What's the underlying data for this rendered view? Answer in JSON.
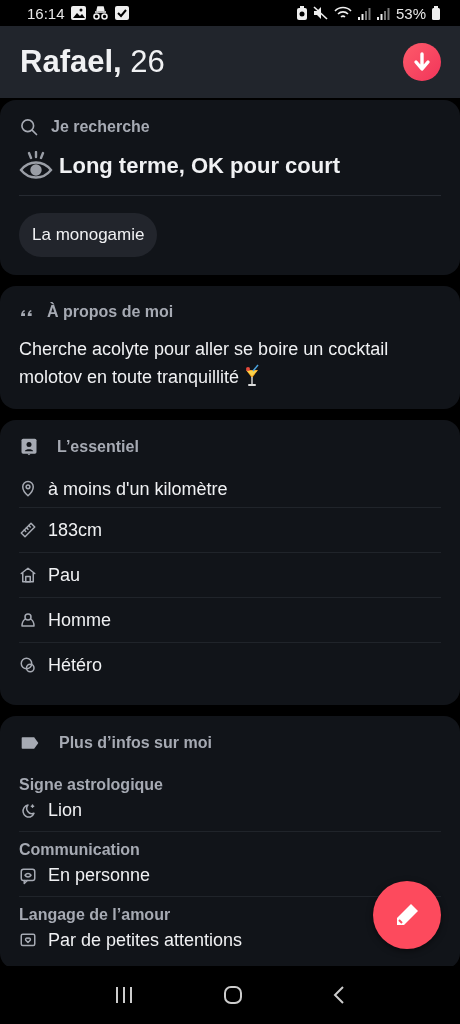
{
  "status_bar": {
    "time": "16:14",
    "battery": "53%"
  },
  "header": {
    "name": "Rafael,",
    "age": "26"
  },
  "sections": [
    {
      "kind": "looking_for",
      "title": "Je recherche",
      "headline": "Long terme, OK pour court",
      "tags": [
        "La monogamie"
      ]
    },
    {
      "kind": "about",
      "title": "À propos de moi",
      "text": "Cherche acolyte pour aller se boire un cocktail molotov en toute tranquillité"
    },
    {
      "kind": "basics",
      "title": "L’essentiel",
      "items": [
        "à moins d'un kilomètre",
        "183cm",
        "Pau",
        "Homme",
        "Hétéro"
      ]
    },
    {
      "kind": "more",
      "title": "Plus d’infos sur moi",
      "groups": [
        {
          "label": "Signe astrologique",
          "value": "Lion"
        },
        {
          "label": "Communication",
          "value": "En personne"
        },
        {
          "label": "Langage de l’amour",
          "value": "Par de petites attentions"
        }
      ]
    }
  ]
}
